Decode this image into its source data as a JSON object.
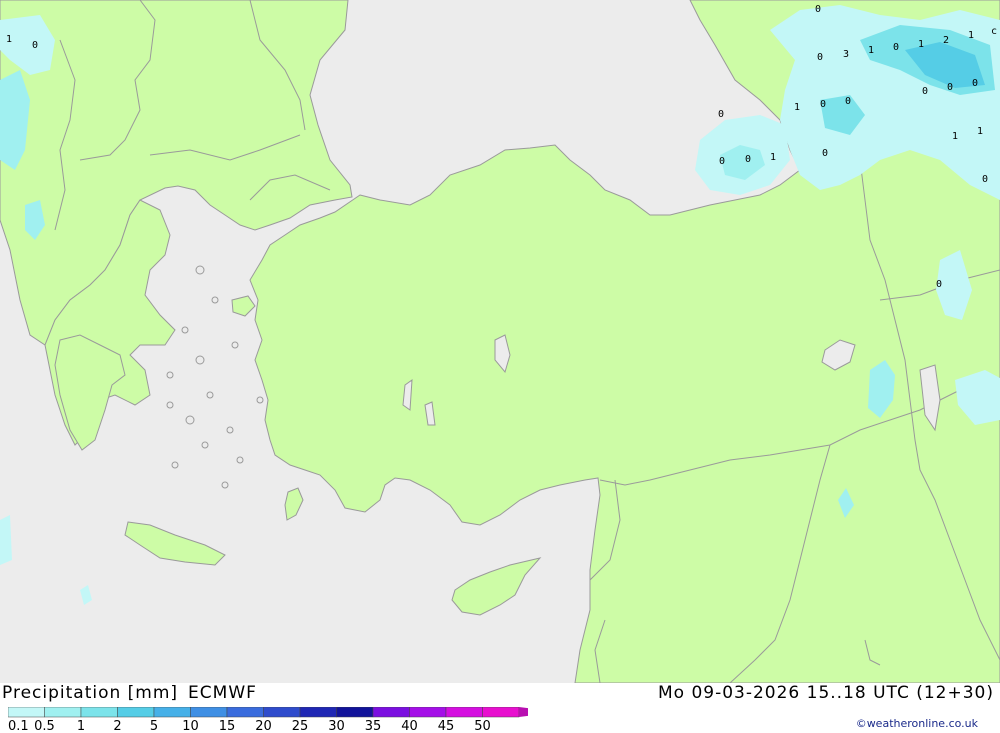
{
  "map": {
    "precip_labels": [
      "1",
      "0",
      "0",
      "0",
      "3",
      "1",
      "0",
      "1",
      "2",
      "1",
      "c",
      "0",
      "0",
      "0",
      "1",
      "0",
      "0",
      "0",
      "0",
      "1",
      "0",
      "1",
      "1",
      "0",
      "0"
    ]
  },
  "footer": {
    "title": "Precipitation [mm]",
    "model": "ECMWF",
    "valid_time": "Mo 09-03-2026 15..18 UTC (12+30)",
    "credit": "©weatheronline.co.uk"
  },
  "legend": {
    "values": [
      "0.1",
      "0.5",
      "1",
      "2",
      "5",
      "10",
      "15",
      "20",
      "25",
      "30",
      "35",
      "40",
      "45",
      "50"
    ],
    "colors": [
      "#c3f7f7",
      "#a0f0f0",
      "#7ce3ea",
      "#55cde6",
      "#46b0e8",
      "#3f8fe4",
      "#3a6cdd",
      "#2f4ccc",
      "#1f27b4",
      "#12139a",
      "#7b0fe0",
      "#a50fe8",
      "#d50fe0",
      "#e80fcf",
      "#b80fb0"
    ]
  },
  "colors": {
    "sea": "#ececec",
    "land": "#cdfca6",
    "border": "#9a9a9a"
  }
}
